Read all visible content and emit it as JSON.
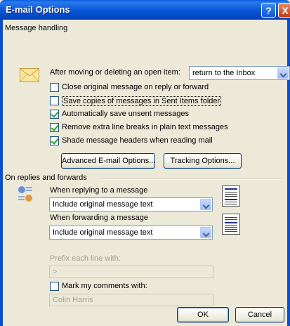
{
  "window": {
    "title": "E-mail Options",
    "help_glyph": "?",
    "close_glyph": "X"
  },
  "message_handling": {
    "label": "Message handling",
    "after_moving_label": "After moving or deleting an open item:",
    "after_moving_value": "return to the Inbox",
    "options": [
      {
        "label": "Close original message on reply or forward",
        "checked": false
      },
      {
        "label": "Save copies of messages in Sent Items folder",
        "checked": false
      },
      {
        "label": "Automatically save unsent messages",
        "checked": true
      },
      {
        "label": "Remove extra line breaks in plain text messages",
        "checked": true
      },
      {
        "label": "Shade message headers when reading mail",
        "checked": true
      }
    ],
    "advanced_button": "Advanced E-mail Options...",
    "tracking_button": "Tracking Options..."
  },
  "replies_forwards": {
    "label": "On replies and forwards",
    "replying_label": "When replying to a message",
    "replying_value": "Include original message text",
    "forwarding_label": "When forwarding a message",
    "forwarding_value": "Include original message text",
    "prefix_label": "Prefix each line with:",
    "prefix_value": ">",
    "mark_label": "Mark my comments with:",
    "mark_checked": false,
    "mark_value": "Colin Harris"
  },
  "footer": {
    "ok": "OK",
    "cancel": "Cancel"
  }
}
